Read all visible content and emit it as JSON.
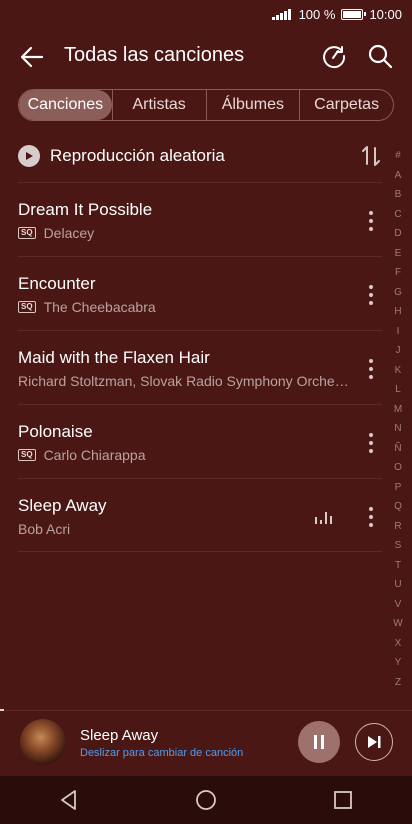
{
  "status": {
    "battery_text": "100 %",
    "time": "10:00"
  },
  "toolbar": {
    "title": "Todas las canciones"
  },
  "tabs": [
    {
      "label": "Canciones",
      "active": true
    },
    {
      "label": "Artistas",
      "active": false
    },
    {
      "label": "Álbumes",
      "active": false
    },
    {
      "label": "Carpetas",
      "active": false
    }
  ],
  "shuffle": {
    "label": "Reproducción aleatoria"
  },
  "songs": [
    {
      "title": "Dream It Possible",
      "artist": "Delacey",
      "sq": "SQ"
    },
    {
      "title": "Encounter",
      "artist": "The Cheebacabra",
      "sq": "SQ"
    },
    {
      "title": "Maid with the Flaxen Hair",
      "artist": "Richard Stoltzman, Slovak Radio Symphony Orche…"
    },
    {
      "title": "Polonaise",
      "artist": "Carlo Chiarappa",
      "sq": "SQ"
    },
    {
      "title": "Sleep Away",
      "artist": "Bob Acri",
      "playing": true
    }
  ],
  "alphabet": [
    "#",
    "A",
    "B",
    "C",
    "D",
    "E",
    "F",
    "G",
    "H",
    "I",
    "J",
    "K",
    "L",
    "M",
    "N",
    "Ñ",
    "O",
    "P",
    "Q",
    "R",
    "S",
    "T",
    "U",
    "V",
    "W",
    "X",
    "Y",
    "Z"
  ],
  "player": {
    "track": "Sleep Away",
    "hint": "Deslizar para cambiar de canción",
    "progress": 0.01
  },
  "colors": {
    "background": "#4a1714",
    "accent_link": "#4f9df0",
    "navbar": "#2a0c0a"
  }
}
